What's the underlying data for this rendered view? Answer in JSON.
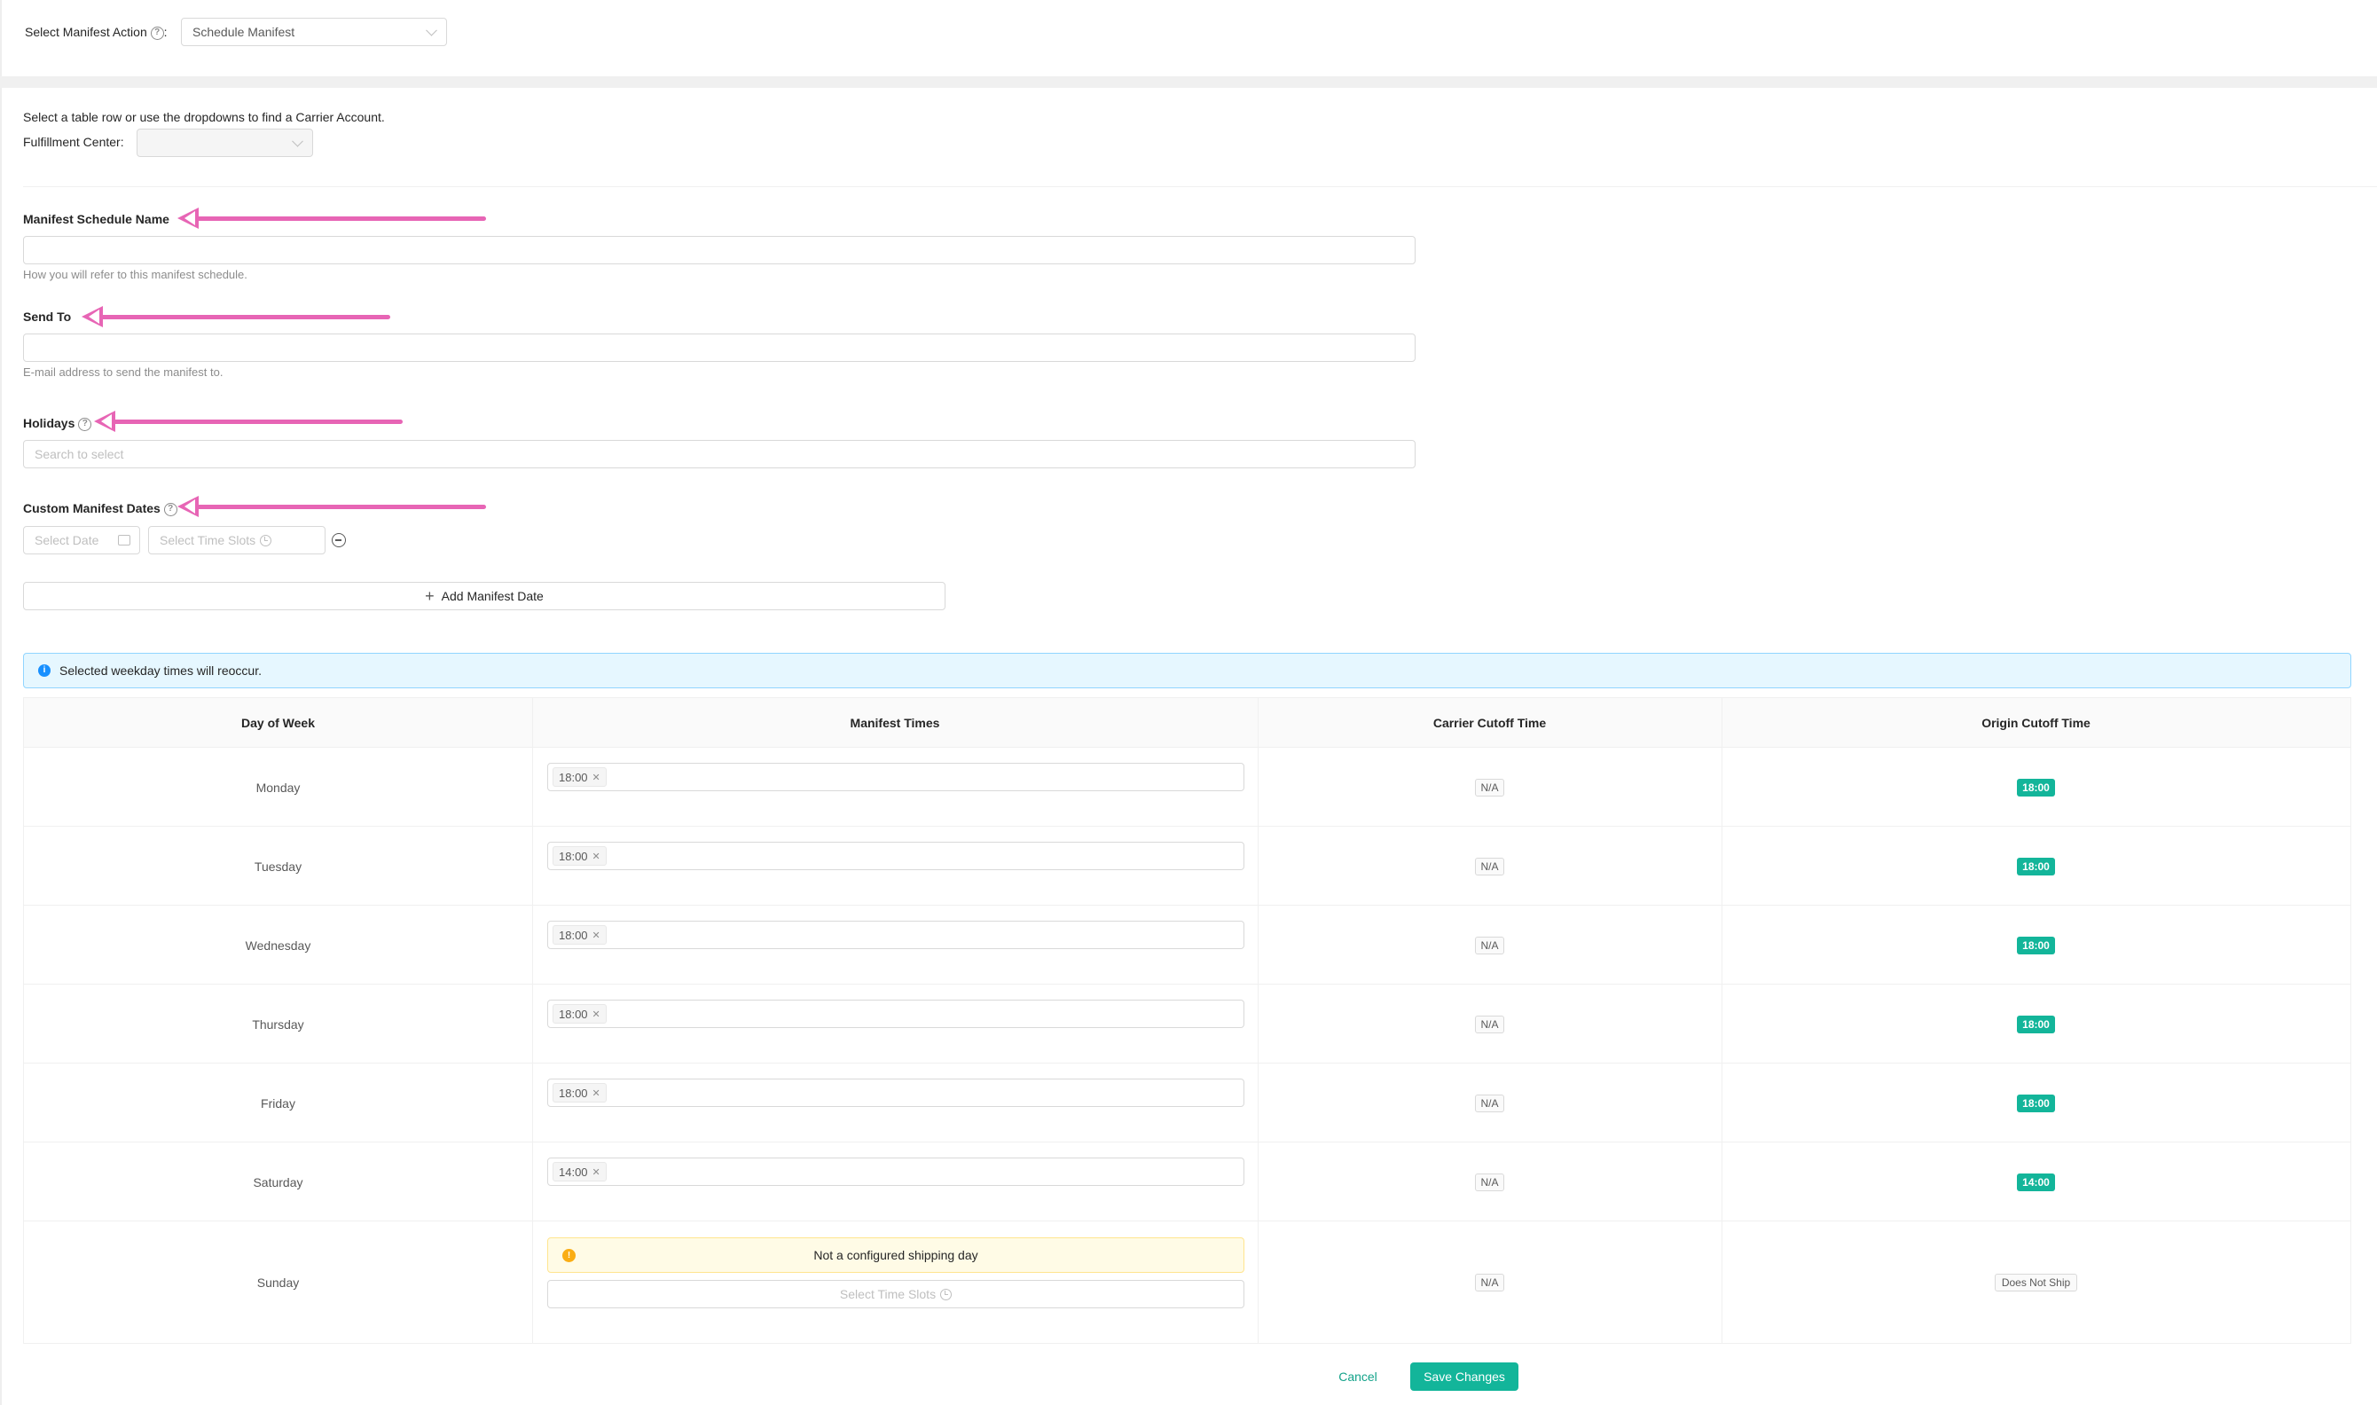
{
  "manifest_action": {
    "label": "Select Manifest Action",
    "value": "Schedule Manifest"
  },
  "carrier_section": {
    "hint": "Select a table row or use the dropdowns to find a Carrier Account.",
    "fulfillment_label": "Fulfillment Center",
    "fulfillment_value": ""
  },
  "form": {
    "schedule_name_label": "Manifest Schedule Name",
    "schedule_name_value": "",
    "schedule_name_help": "How you will refer to this manifest schedule.",
    "send_to_label": "Send To",
    "send_to_value": "",
    "send_to_help": "E-mail address to send the manifest to.",
    "holidays_label": "Holidays",
    "holidays_placeholder": "Search to select",
    "custom_dates_label": "Custom Manifest Dates",
    "select_date_placeholder": "Select Date",
    "select_time_slots_placeholder": "Select Time Slots",
    "add_date_label": "Add Manifest Date"
  },
  "info_message": "Selected weekday times will reoccur.",
  "table": {
    "headers": [
      "Day of Week",
      "Manifest Times",
      "Carrier Cutoff Time",
      "Origin Cutoff Time"
    ],
    "rows": [
      {
        "day": "Monday",
        "time": "18:00",
        "carrier_cutoff": "N/A",
        "origin_cutoff": "18:00"
      },
      {
        "day": "Tuesday",
        "time": "18:00",
        "carrier_cutoff": "N/A",
        "origin_cutoff": "18:00"
      },
      {
        "day": "Wednesday",
        "time": "18:00",
        "carrier_cutoff": "N/A",
        "origin_cutoff": "18:00"
      },
      {
        "day": "Thursday",
        "time": "18:00",
        "carrier_cutoff": "N/A",
        "origin_cutoff": "18:00"
      },
      {
        "day": "Friday",
        "time": "18:00",
        "carrier_cutoff": "N/A",
        "origin_cutoff": "18:00"
      },
      {
        "day": "Saturday",
        "time": "14:00",
        "carrier_cutoff": "N/A",
        "origin_cutoff": "14:00"
      },
      {
        "day": "Sunday",
        "warning": "Not a configured shipping day",
        "slot_placeholder": "Select Time Slots",
        "carrier_cutoff": "N/A",
        "origin_cutoff": "Does Not Ship"
      }
    ]
  },
  "footer": {
    "cancel_label": "Cancel",
    "save_label": "Save Changes"
  },
  "colors": {
    "accent": "#13b59a",
    "annotation_arrow": "#e765b5",
    "info_bg": "#e6f7ff",
    "warning_bg": "#fffbe6"
  }
}
